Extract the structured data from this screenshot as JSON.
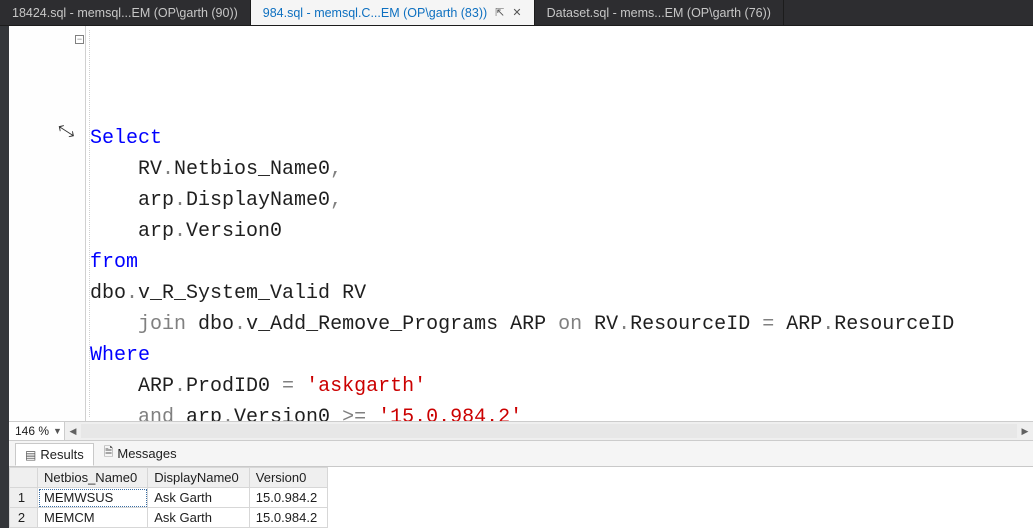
{
  "tabs": [
    {
      "label": "18424.sql - memsql...EM (OP\\garth (90))",
      "active": false
    },
    {
      "label": "984.sql - memsql.C...EM (OP\\garth (83))",
      "active": true,
      "pinned": true
    },
    {
      "label": "Dataset.sql - mems...EM (OP\\garth (76))",
      "active": false
    }
  ],
  "zoom": "146 %",
  "code": {
    "outline_glyph": "−",
    "lines": [
      [
        {
          "cls": "kw",
          "t": "Select"
        }
      ],
      [
        {
          "cls": "id",
          "t": "    RV"
        },
        {
          "cls": "op",
          "t": "."
        },
        {
          "cls": "id",
          "t": "Netbios_Name0"
        },
        {
          "cls": "op",
          "t": ","
        }
      ],
      [
        {
          "cls": "id",
          "t": "    arp"
        },
        {
          "cls": "op",
          "t": "."
        },
        {
          "cls": "id",
          "t": "DisplayName0"
        },
        {
          "cls": "op",
          "t": ","
        }
      ],
      [
        {
          "cls": "id",
          "t": "    arp"
        },
        {
          "cls": "op",
          "t": "."
        },
        {
          "cls": "id",
          "t": "Version0"
        }
      ],
      [
        {
          "cls": "kw",
          "t": "from"
        }
      ],
      [
        {
          "cls": "id",
          "t": "dbo"
        },
        {
          "cls": "op",
          "t": "."
        },
        {
          "cls": "id",
          "t": "v_R_System_Valid RV"
        }
      ],
      [
        {
          "cls": "grey",
          "t": "    join "
        },
        {
          "cls": "id",
          "t": "dbo"
        },
        {
          "cls": "op",
          "t": "."
        },
        {
          "cls": "id",
          "t": "v_Add_Remove_Programs ARP "
        },
        {
          "cls": "grey",
          "t": "on "
        },
        {
          "cls": "id",
          "t": "RV"
        },
        {
          "cls": "op",
          "t": "."
        },
        {
          "cls": "id",
          "t": "ResourceID "
        },
        {
          "cls": "op",
          "t": "= "
        },
        {
          "cls": "id",
          "t": "ARP"
        },
        {
          "cls": "op",
          "t": "."
        },
        {
          "cls": "id",
          "t": "ResourceID"
        }
      ],
      [
        {
          "cls": "kw",
          "t": "Where"
        }
      ],
      [
        {
          "cls": "id",
          "t": "    ARP"
        },
        {
          "cls": "op",
          "t": "."
        },
        {
          "cls": "id",
          "t": "ProdID0 "
        },
        {
          "cls": "op",
          "t": "= "
        },
        {
          "cls": "str",
          "t": "'askgarth'"
        }
      ],
      [
        {
          "cls": "grey",
          "t": "    and "
        },
        {
          "cls": "id",
          "t": "arp"
        },
        {
          "cls": "op",
          "t": "."
        },
        {
          "cls": "id",
          "t": "Version0 "
        },
        {
          "cls": "op",
          "t": ">= "
        },
        {
          "cls": "str",
          "t": "'15.0.984.2'"
        }
      ]
    ]
  },
  "results_tabs": {
    "results": "Results",
    "messages": "Messages"
  },
  "grid": {
    "columns": [
      "Netbios_Name0",
      "DisplayName0",
      "Version0"
    ],
    "rows": [
      {
        "n": "1",
        "cells": [
          "MEMWSUS",
          "Ask Garth",
          "15.0.984.2"
        ],
        "selected_col": 0
      },
      {
        "n": "2",
        "cells": [
          "MEMCM",
          "Ask Garth",
          "15.0.984.2"
        ]
      }
    ]
  },
  "icons": {
    "pin": "⇱",
    "close": "✕",
    "grid": "▤",
    "messages": "🗎",
    "dropdown": "▼",
    "scroll_left": "◀",
    "scroll_right": "▶",
    "cursor": "⤡"
  }
}
